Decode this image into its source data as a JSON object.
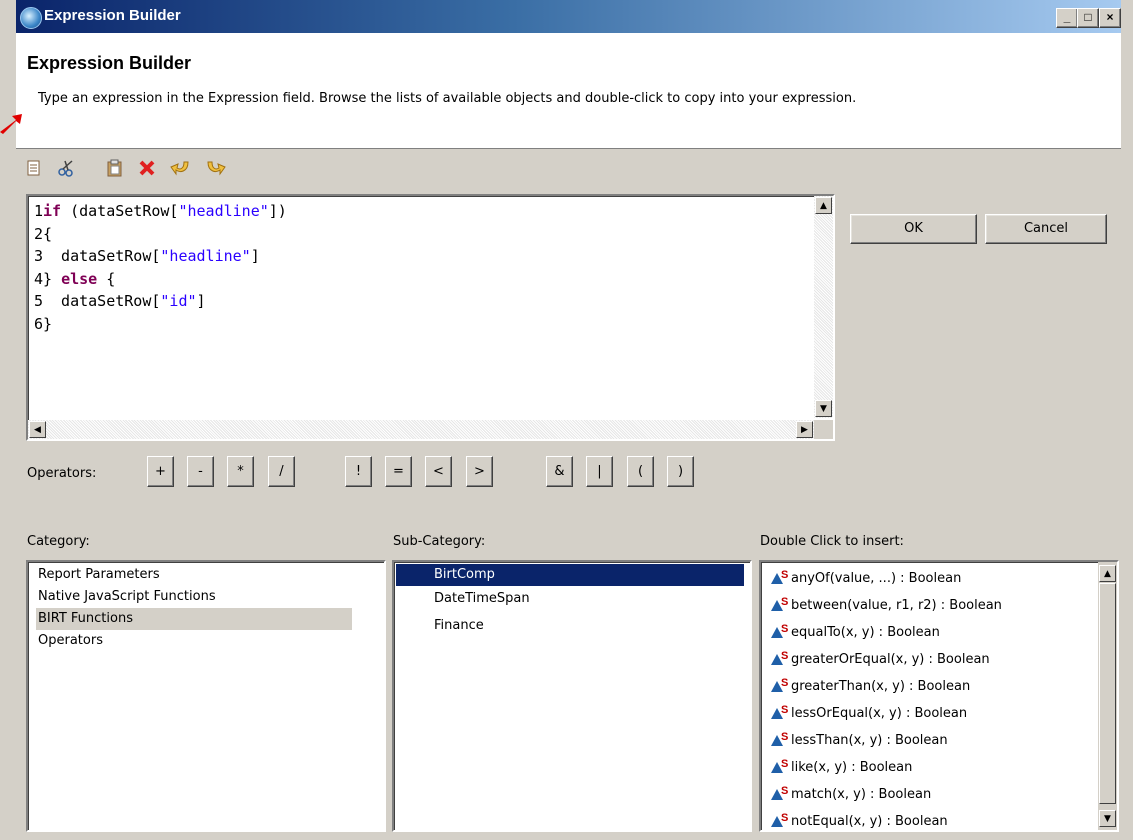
{
  "window": {
    "title": "Expression Builder",
    "controls": [
      "_",
      "□",
      "×"
    ]
  },
  "header": {
    "title": "Expression Builder",
    "description": "Type an expression in the Expression field. Browse the lists of available objects and double-click to copy into your expression."
  },
  "toolbar": {
    "icons": [
      "copy-icon",
      "cut-icon",
      "paste-icon",
      "delete-icon",
      "undo-icon",
      "redo-icon"
    ]
  },
  "editor": {
    "line_numbers": [
      "1",
      "2",
      "3",
      "4",
      "5",
      "6"
    ],
    "lines": [
      "if (dataSetRow[\"headline\"])",
      "{",
      "  dataSetRow[\"headline\"]",
      "} else {",
      "  dataSetRow[\"id\"]",
      "}"
    ]
  },
  "actions": {
    "ok": "OK",
    "cancel": "Cancel"
  },
  "operators": {
    "label": "Operators:",
    "buttons": [
      "+",
      "-",
      "*",
      "/",
      "!",
      "=",
      "<",
      ">",
      "&",
      "|",
      "(",
      ")"
    ]
  },
  "category": {
    "label": "Category:",
    "items": [
      "Report Parameters",
      "Native JavaScript Functions",
      "BIRT Functions",
      "Operators"
    ],
    "selected": "BIRT Functions"
  },
  "subcategory": {
    "label": "Sub-Category:",
    "items": [
      "BirtComp",
      "DateTimeSpan",
      "Finance"
    ],
    "selected": "BirtComp"
  },
  "insert": {
    "label": "Double Click to insert:",
    "items": [
      "anyOf(value, ...) : Boolean",
      "between(value, r1, r2) : Boolean",
      "equalTo(x, y) : Boolean",
      "greaterOrEqual(x, y) : Boolean",
      "greaterThan(x, y) : Boolean",
      "lessOrEqual(x, y) : Boolean",
      "lessThan(x, y) : Boolean",
      "like(x, y) : Boolean",
      "match(x, y) : Boolean",
      "notEqual(x, y) : Boolean"
    ],
    "icon_badge": "S"
  },
  "colors": {
    "keyword": "#7f0055",
    "string": "#2a00ff",
    "selection": "#0a246a"
  }
}
